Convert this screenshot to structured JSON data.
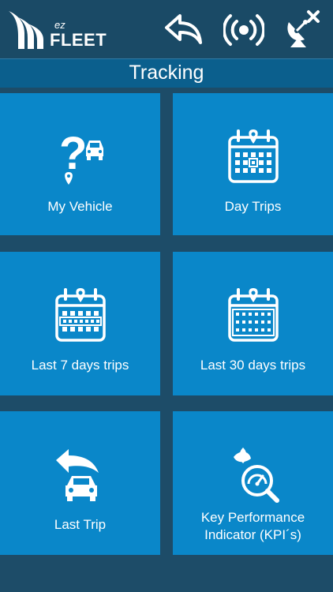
{
  "app": {
    "logo_ez": "ez",
    "logo_fleet": "FLEET"
  },
  "header": {
    "title": "Tracking",
    "icons": [
      "back-icon",
      "broadcast-icon",
      "satellite-disconnect-icon"
    ]
  },
  "tiles": [
    {
      "label": "My Vehicle",
      "icon": "vehicle-question-icon"
    },
    {
      "label": "Day Trips",
      "icon": "calendar-day-icon"
    },
    {
      "label": "Last 7 days trips",
      "icon": "calendar-week-icon"
    },
    {
      "label": "Last 30 days trips",
      "icon": "calendar-month-icon"
    },
    {
      "label": "Last Trip",
      "icon": "car-return-icon"
    },
    {
      "label": "Key Performance Indicator (KPI´s)",
      "icon": "kpi-magnifier-icon"
    }
  ],
  "colors": {
    "header_bg": "#1a4a66",
    "title_bg": "#0b5f8d",
    "tile_bg": "#0a87c9",
    "gap_bg": "#1d4c68",
    "text": "#ffffff"
  }
}
